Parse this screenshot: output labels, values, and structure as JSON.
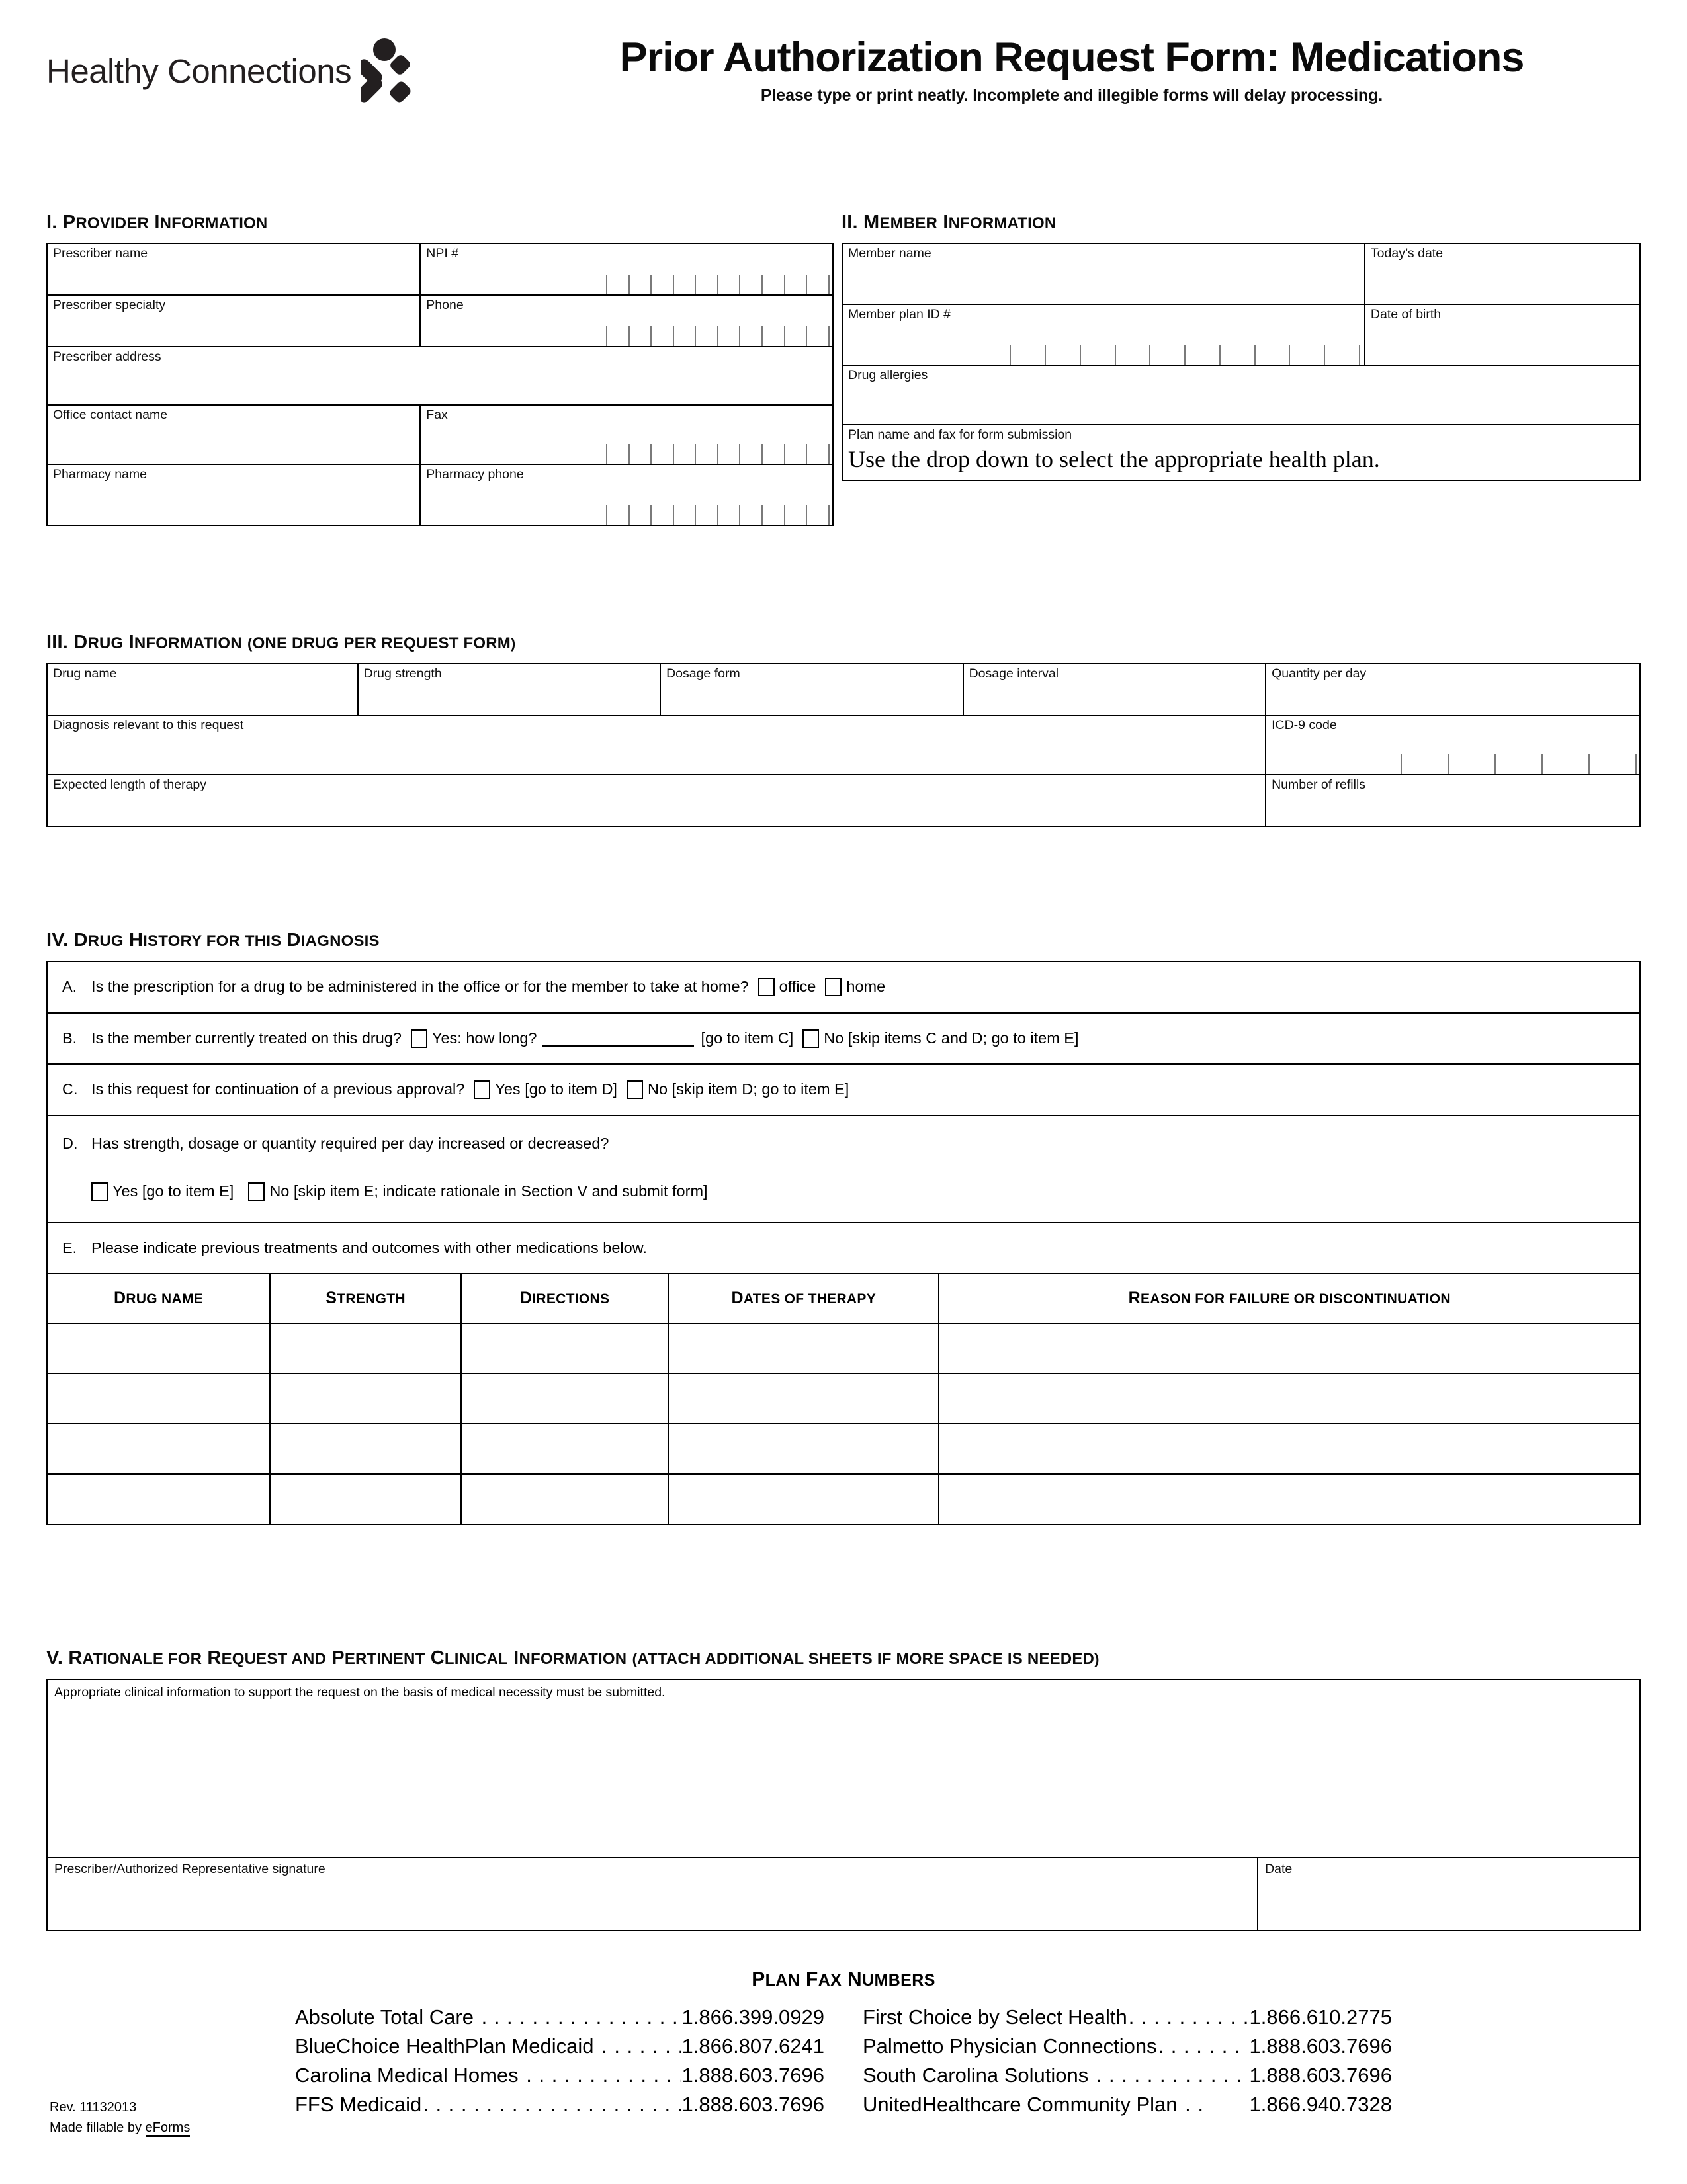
{
  "header": {
    "logo_text": "Healthy Connections",
    "logo_icon": "healthy-connections-person-logo",
    "title": "Prior Authorization Request Form: Medications",
    "subtitle": "Please type or print neatly. Incomplete and illegible forms will delay processing."
  },
  "section1": {
    "heading_num": "I.",
    "heading_a": "P",
    "heading_b": "ROVIDER ",
    "heading_c": "I",
    "heading_d": "NFORMATION",
    "heading_full": "I. PROVIDER INFORMATION",
    "fields": {
      "prescriber_name": "Prescriber name",
      "npi": "NPI #",
      "prescriber_specialty": "Prescriber specialty",
      "phone": "Phone",
      "prescriber_address": "Prescriber address",
      "office_contact_name": "Office contact name",
      "fax": "Fax",
      "pharmacy_name": "Pharmacy name",
      "pharmacy_phone": "Pharmacy phone"
    }
  },
  "section2": {
    "heading_full": "II. MEMBER INFORMATION",
    "fields": {
      "member_name": "Member name",
      "todays_date": "Today’s date",
      "member_plan_id": "Member plan ID #",
      "date_of_birth": "Date of birth",
      "drug_allergies": "Drug allergies",
      "plan_name_fax": "Plan name and fax for form submission"
    },
    "plan_dropdown_value": "Use the drop down to select the appropriate health plan."
  },
  "section3": {
    "heading_full": "III. DRUG INFORMATION (ONE DRUG PER REQUEST FORM)",
    "fields": {
      "drug_name": "Drug name",
      "drug_strength": "Drug strength",
      "dosage_form": "Dosage form",
      "dosage_interval": "Dosage interval",
      "quantity_per_day": "Quantity per day",
      "diagnosis": "Diagnosis relevant to this request",
      "icd9": "ICD-9 code",
      "expected_length": "Expected length of therapy",
      "refills": "Number of refills"
    }
  },
  "section4": {
    "heading_full": "IV. DRUG HISTORY FOR THIS DIAGNOSIS",
    "qa": {
      "letter": "A.",
      "text": "Is the prescription for a drug to be administered in the office or for the member to take at home?",
      "opt1": "office",
      "opt2": "home"
    },
    "qb": {
      "letter": "B.",
      "text": "Is the member currently treated on this drug?",
      "opt1": "Yes: how long?",
      "note1": "[go to item C]",
      "opt2": "No [skip items C and D; go to item E]"
    },
    "qc": {
      "letter": "C.",
      "text": "Is this request for continuation of a previous approval?",
      "opt1": "Yes [go to item D]",
      "opt2": "No [skip item D; go to item E]"
    },
    "qd": {
      "letter": "D.",
      "text": "Has strength, dosage or quantity required per day increased or decreased?",
      "opt1": "Yes [go to item E]",
      "opt2": "No [skip item E; indicate rationale in Section V and submit form]"
    },
    "qe": {
      "letter": "E.",
      "text": "Please indicate previous treatments and outcomes with other medications below."
    },
    "history_table": {
      "columns": [
        "DRUG NAME",
        "STRENGTH",
        "DIRECTIONS",
        "DATES OF THERAPY",
        "REASON FOR FAILURE OR DISCONTINUATION"
      ],
      "rows": [
        [
          "",
          "",
          "",
          "",
          ""
        ],
        [
          "",
          "",
          "",
          "",
          ""
        ],
        [
          "",
          "",
          "",
          "",
          ""
        ],
        [
          "",
          "",
          "",
          "",
          ""
        ]
      ]
    }
  },
  "section5": {
    "heading_full": "V. RATIONALE FOR REQUEST AND PERTINENT CLINICAL INFORMATION (ATTACH ADDITIONAL SHEETS IF MORE SPACE IS NEEDED)",
    "note": "Appropriate clinical information to support the request on the basis of medical necessity must be submitted.",
    "signature_label": "Prescriber/Authorized Representative signature",
    "date_label": "Date"
  },
  "fax": {
    "title": "PLAN FAX NUMBERS",
    "left": [
      {
        "name": "Absolute Total Care",
        "number": "1.866.399.0929"
      },
      {
        "name": "BlueChoice HealthPlan Medicaid",
        "number": "1.866.807.6241"
      },
      {
        "name": "Carolina Medical Homes",
        "number": "1.888.603.7696"
      },
      {
        "name": "FFS Medicaid",
        "number": "1.888.603.7696"
      }
    ],
    "right": [
      {
        "name": "First Choice by Select Health",
        "number": "1.866.610.2775"
      },
      {
        "name": "Palmetto Physician Connections",
        "number": "1.888.603.7696"
      },
      {
        "name": "South Carolina Solutions",
        "number": "1.888.603.7696"
      },
      {
        "name": "UnitedHealthcare Community Plan",
        "number": "1.866.940.7328"
      }
    ]
  },
  "footer": {
    "revision": "Rev. 11132013",
    "made_fillable_prefix": "Made fillable by ",
    "made_fillable_link": "eForms"
  }
}
